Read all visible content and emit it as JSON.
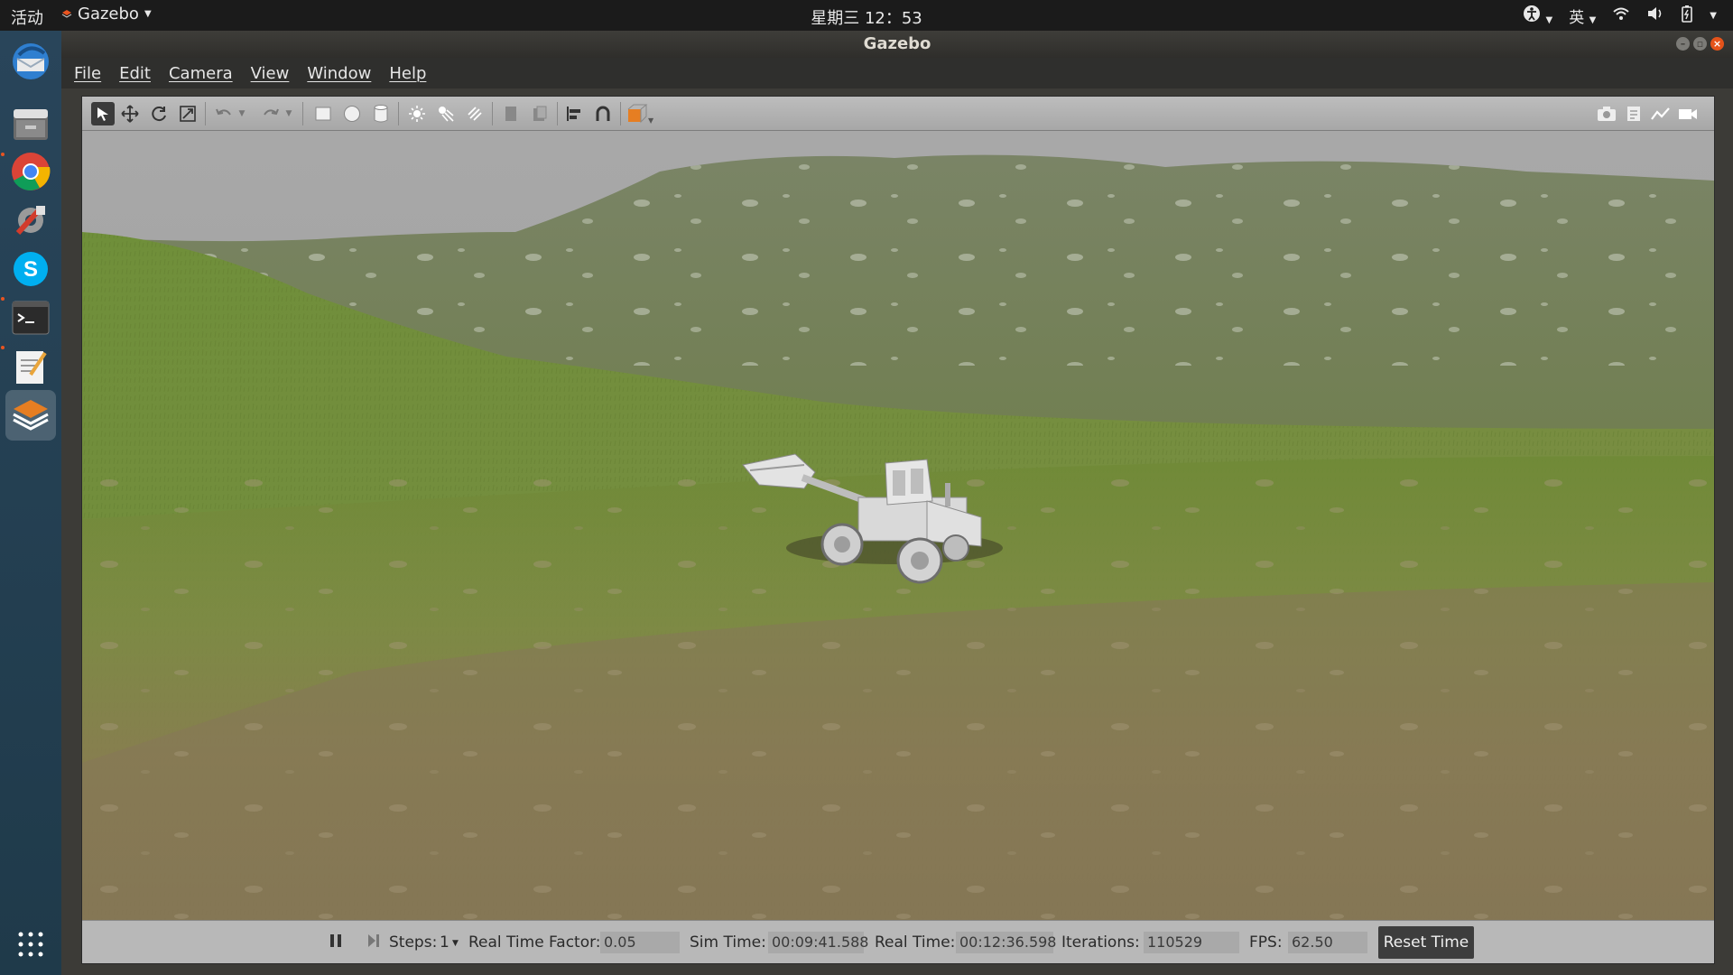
{
  "topbar": {
    "activities": "活动",
    "app_name": "Gazebo",
    "clock": "星期三 12：53",
    "input_method": "英"
  },
  "window": {
    "title": "Gazebo"
  },
  "menu": {
    "items": [
      "File",
      "Edit",
      "Camera",
      "View",
      "Window",
      "Help"
    ]
  },
  "dock": {
    "apps": [
      "thunderbird-icon",
      "files-icon",
      "chrome-icon",
      "settings-tool-icon",
      "skype-icon",
      "terminal-icon",
      "text-editor-icon",
      "gazebo-icon",
      "show-apps-icon"
    ]
  },
  "statusbar": {
    "steps_label": "Steps:",
    "steps_value": "1",
    "rtf_label": "Real Time Factor:",
    "rtf_value": "0.05",
    "sim_time_label": "Sim Time:",
    "sim_time_value": "00:09:41.588",
    "real_time_label": "Real Time:",
    "real_time_value": "00:12:36.598",
    "iterations_label": "Iterations:",
    "iterations_value": "110529",
    "fps_label": "FPS:",
    "fps_value": "62.50",
    "reset_label": "Reset Time"
  },
  "colors": {
    "accent": "#e95420",
    "sky": "#a6a6a6",
    "grass": "#6f8a3a",
    "dirt": "#8a7a52"
  }
}
